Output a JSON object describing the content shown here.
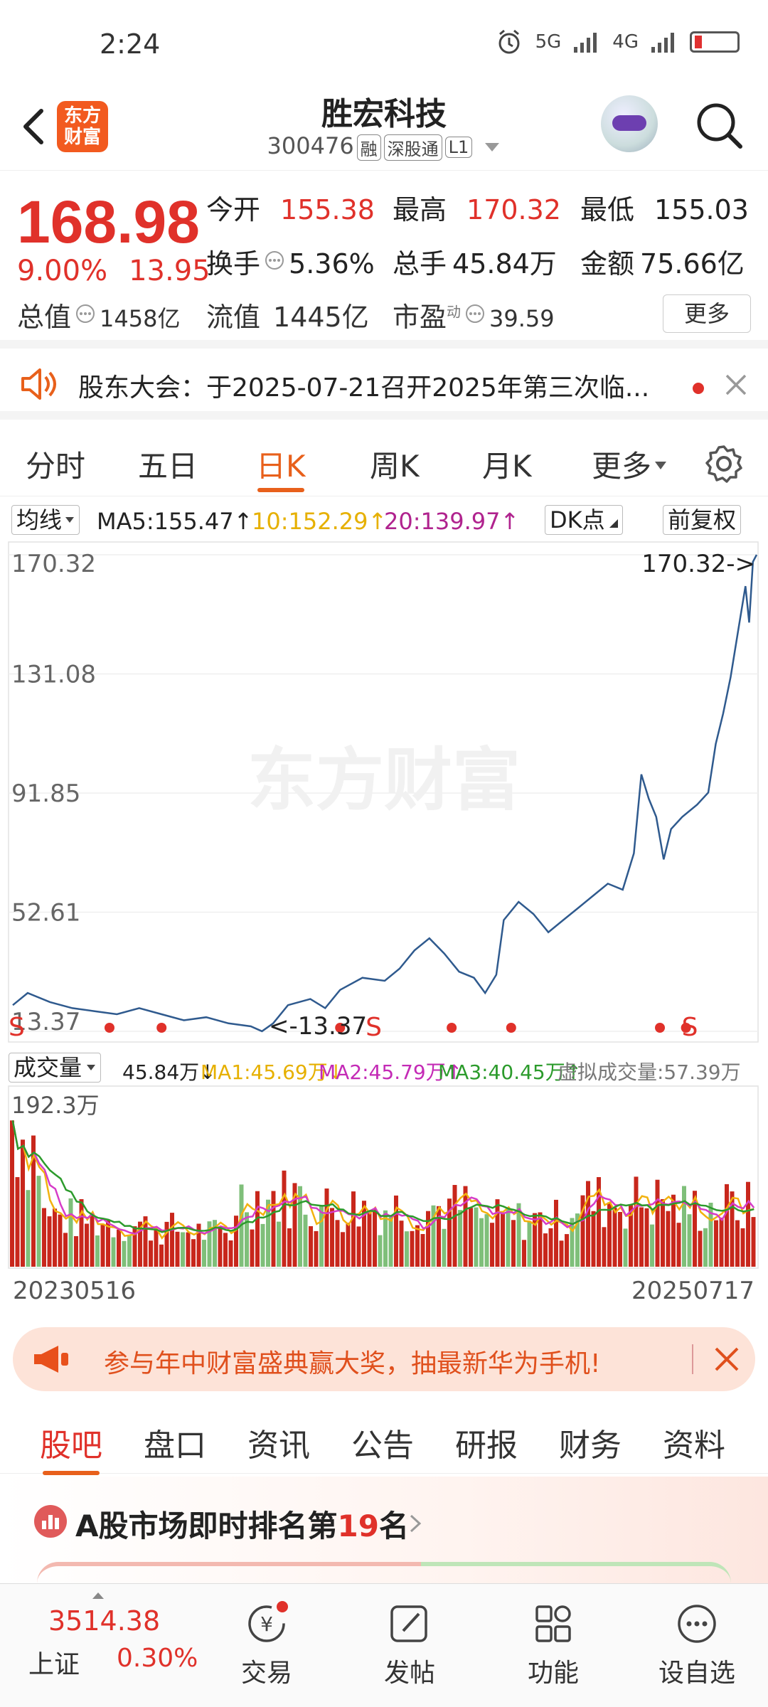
{
  "status": {
    "time": "2:24",
    "network1": "5G",
    "network2": "4G"
  },
  "header": {
    "logo_line1": "东方",
    "logo_line2": "财富",
    "name": "胜宏科技",
    "code": "300476",
    "tags": [
      "融",
      "深股通",
      "L1"
    ]
  },
  "quote": {
    "price": "168.98",
    "change_pct": "9.00%",
    "change": "13.95",
    "open_label": "今开",
    "open": "155.38",
    "high_label": "最高",
    "high": "170.32",
    "low_label": "最低",
    "low": "155.03",
    "turnover_label": "换手",
    "turnover": "5.36%",
    "volume_label": "总手",
    "volume": "45.84万",
    "amount_label": "金额",
    "amount": "75.66亿",
    "mktcap_label": "总值",
    "mktcap": "1458亿",
    "float_label": "流值",
    "float": "1445亿",
    "pe_label": "市盈",
    "pe_sup": "动",
    "pe": "39.59",
    "more": "更多"
  },
  "notice": {
    "text": "股东大会：于2025-07-21召开2025年第三次临..."
  },
  "period_tabs": [
    "分时",
    "五日",
    "日K",
    "周K",
    "月K",
    "更多"
  ],
  "active_period": 2,
  "ma_bar": {
    "selector": "均线",
    "ma5": "MA5:155.47↑",
    "ma10": "10:152.29↑",
    "ma20": "20:139.97↑",
    "dk": "DK点",
    "adjust": "前复权"
  },
  "chart_data": [
    {
      "type": "line",
      "y_ticks": [
        "170.32",
        "131.08",
        "91.85",
        "52.61",
        "13.37"
      ],
      "ylim": [
        13.37,
        170.32
      ],
      "high_marker": "170.32->",
      "low_marker": "<-13.37",
      "signals": [
        "S",
        "S",
        "S"
      ],
      "watermark": "东方财富",
      "colors": {
        "line": "#2f5a8e",
        "signal": "#e0312a"
      }
    },
    {
      "type": "bar",
      "max_label": "192.3万",
      "x_start": "20230516",
      "x_end": "20250717",
      "colors": {
        "up": "#c8271c",
        "down": "#7fbf7a",
        "ma1": "#f2b20f",
        "ma2": "#d63cc8",
        "ma3": "#2c9b2c"
      }
    }
  ],
  "volume_bar": {
    "selector": "成交量",
    "vol": "45.84万↓",
    "ma1": "MA1:45.69万↓",
    "ma2": "MA2:45.79万↑",
    "ma3": "MA3:40.45万↑",
    "virtual": "虚拟成交量:57.39万"
  },
  "promo": {
    "text": "参与年中财富盛典赢大奖，抽最新华为手机!"
  },
  "content_tabs": [
    "股吧",
    "盘口",
    "资讯",
    "公告",
    "研报",
    "财务",
    "资料"
  ],
  "rank": {
    "prefix": "A股市场即时排名第",
    "num": "19",
    "suffix": "名"
  },
  "bottom_nav": {
    "index_value": "3514.38",
    "index_name": "上证",
    "index_pct": "0.30%",
    "items": [
      "交易",
      "发帖",
      "功能",
      "设自选"
    ]
  }
}
